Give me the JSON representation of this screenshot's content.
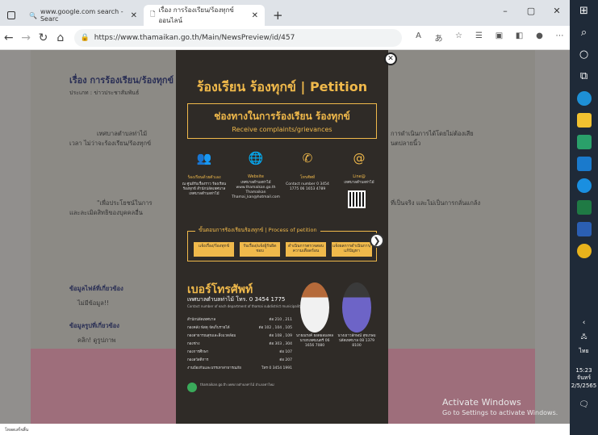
{
  "browser": {
    "tabs": [
      {
        "label": "www.google.com search - Searc",
        "active": false
      },
      {
        "label": "เรื่อง การร้องเรียน/ร้องทุกข์ออนไลน์",
        "active": true
      }
    ],
    "url": "https://www.thamaikan.go.th/Main/NewsPreview/id/457",
    "window_controls": [
      "–",
      "▢",
      "✕"
    ]
  },
  "background_page": {
    "article_title": "เรื่อง การร้องเรียน/ร้องทุกข์",
    "article_meta": "ประเภท : ข่าวประชาสัมพันธ์",
    "left_lines": [
      "เทศบาลตำบลท่าไม้",
      "เวลา ไม่ว่าจะร้องเรียน/ร้องทุกข์",
      "\"เพื่อประโยชน์ในการ",
      "และละเมิดสิทธิของบุคคลอื่น"
    ],
    "right_lines": [
      "การดำเนินการได้โดยไม่ต้องเสีย",
      "นตปลายนิ้ว",
      "ที่เป็นจริง และไม่เป็นการกลั่นแกล้ง"
    ],
    "section_links": [
      "ข้อมูลไฟล์ที่เกี่ยวข้อง",
      "ไม่มีข้อมูล!!",
      "ข้อมูลรูปที่เกี่ยวข้อง",
      "คลิก! ดูรูปภาพ"
    ]
  },
  "poster": {
    "title": "ร้องเรียน ร้องทุกข์ | Petition",
    "channels_th": "ช่องทางในการร้องเรียน ร้องทุกข์",
    "channels_en": "Receive complaints/grievances",
    "channels": [
      {
        "icon": "people-icon",
        "label": "ร้องเรียนด้วยตัวเอง",
        "sub": "ณ ศูนย์รับเรื่องราว ร้องเรียน ร้องทุกข์ สำนักปลัดเทศบาล เทศบาลตำบลท่าไม้"
      },
      {
        "icon": "web-icon",
        "label": "Website",
        "sub": "เทศบาลตำบลท่าไม้ www.thamaikan.go.th Thamaikan Thamai_kan@hotmail.com"
      },
      {
        "icon": "phone-icon",
        "label": "โทรศัพท์",
        "sub": "Contact number 0 3454 1775 06 1653 4789"
      },
      {
        "icon": "line-icon",
        "label": "Line@",
        "sub": "เทศบาลตำบลท่าไม้"
      }
    ],
    "process_title": "ขั้นตอนการร้องเรียนร้องทุกข์ | Process of petition",
    "steps": [
      "แจ้งเรื่อง/ร้องทุกข์",
      "รับเรื่อง/แจ้งผู้รับผิดชอบ",
      "ดำเนินการตรวจสอบความเดือดร้อน",
      "แจ้งผลการดำเนินการ/แก้ปัญหา"
    ],
    "phone_title": "เบอร์โทรศัพท์",
    "phone_sub": "เทศบาลตำบลท่าไม้ โทร. 0 3454 1775",
    "phone_note": "Contact number of each department of thamai subdistrict municipality",
    "phone_rows": [
      {
        "dept": "สำนักปลัดเทศบาล",
        "ext": "ต่อ 210 , 211"
      },
      {
        "dept": "กองคลัง พัสดุ จัดเก็บรายได้",
        "ext": "ต่อ 102 , 104 , 105"
      },
      {
        "dept": "กองสาธารณสุขและสิ่งแวดล้อม",
        "ext": "ต่อ 108 , 109"
      },
      {
        "dept": "กองช่าง",
        "ext": "ต่อ 303 , 304"
      },
      {
        "dept": "กองการศึกษา",
        "ext": "ต่อ 107"
      },
      {
        "dept": "กองสวัสดิการ",
        "ext": "ต่อ 207"
      },
      {
        "dept": "งานป้องกันและบรรเทาสาธารณภัย",
        "ext": "โทร 0 3454 1991"
      }
    ],
    "persons": [
      {
        "name": "นายณรงค์ ยอดผลมงคล นายกเทศมนตรี 06 1656 7080"
      },
      {
        "name": "นางเยาวลักษณ์ สุขเกษม ปลัดเทศบาล 08 1379 8100"
      }
    ],
    "footer": "thamaikan.go.th เทศบาลตำบลท่าไม้ อำเภอท่าใหม่"
  },
  "overlay": {
    "activate_title": "Activate Windows",
    "activate_sub": "Go to Settings to activate Windows."
  },
  "taskbar": {
    "time": "15:23",
    "day": "จันทร์",
    "date": "2/5/2565",
    "lang": "ไทย"
  },
  "statusbar": "โหลดเสร็จสิ้น"
}
